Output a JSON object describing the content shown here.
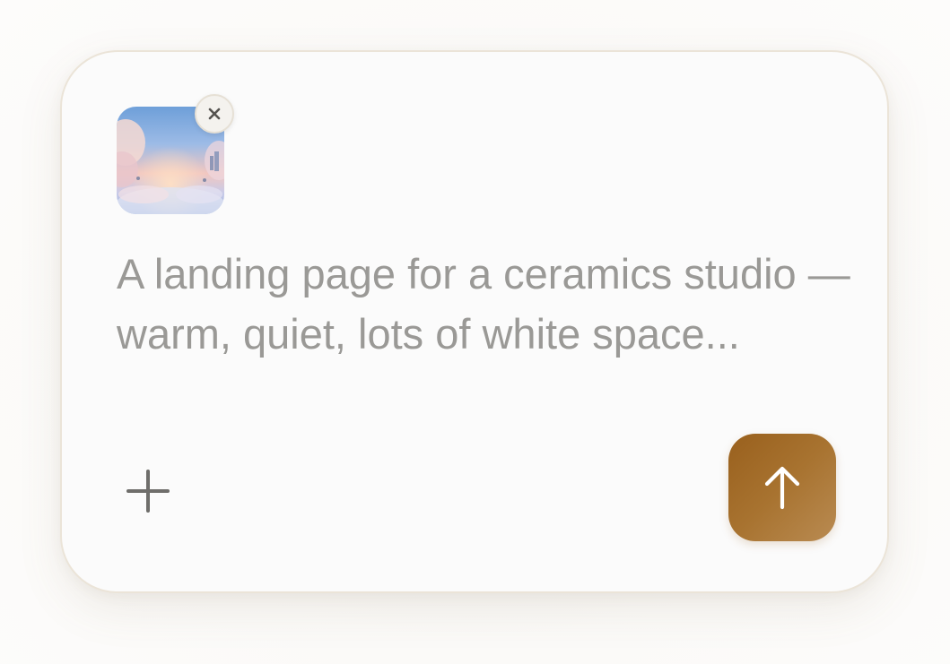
{
  "composer": {
    "attachment": {
      "thumbnail_icon": "sky-clouds-image",
      "remove_icon": "close-icon"
    },
    "prompt": {
      "text": "A landing page for a ceramics studio — warm, quiet, lots of white space..."
    },
    "add_icon": "plus-icon",
    "send_icon": "arrow-up-icon"
  },
  "colors": {
    "card_background": "#fbfbfb",
    "card_border": "#ebe4d8",
    "text": "#9a9996",
    "send_button_start": "#99601d",
    "send_button_end": "#b98b52"
  }
}
